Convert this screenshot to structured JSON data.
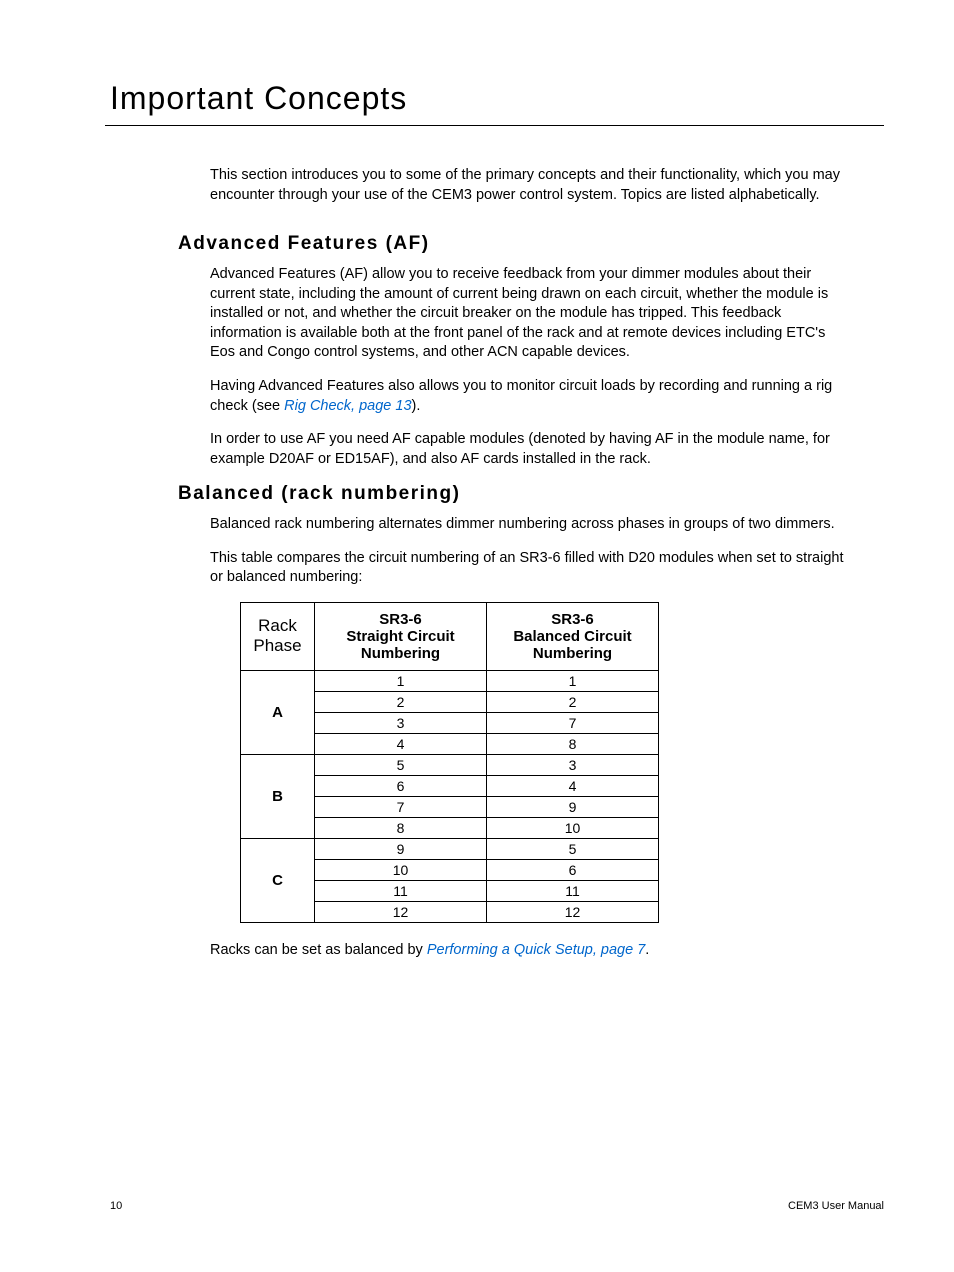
{
  "title": "Important Concepts",
  "intro": "This section introduces you to some of the primary concepts and their functionality, which you may encounter through your use of the CEM3 power control system. Topics are listed alphabetically.",
  "af": {
    "heading": "Advanced Features (AF)",
    "p1": "Advanced Features (AF) allow you to receive feedback from your dimmer modules about their current state, including the amount of current being drawn on each circuit, whether the module is installed or not, and whether the circuit breaker on the module has tripped. This feedback information is available both at the front panel of the rack and at remote devices including ETC's Eos and Congo control systems, and other ACN capable devices.",
    "p2_before": "Having Advanced Features also allows you to monitor circuit loads by recording and running a rig check (see ",
    "p2_link": "Rig Check, page 13",
    "p2_after": ").",
    "p3": "In order to use AF you need AF capable modules (denoted by having AF in the module name, for example D20AF or ED15AF), and also AF cards installed in the rack."
  },
  "balanced": {
    "heading": "Balanced (rack numbering)",
    "p1": "Balanced rack numbering alternates dimmer numbering across phases in groups of two dimmers.",
    "p2": "This table compares the circuit numbering of an SR3-6 filled with D20 modules when set to straight or balanced numbering:",
    "p3_before": "Racks can be set as balanced by ",
    "p3_link": "Performing a Quick Setup, page 7",
    "p3_after": "."
  },
  "table": {
    "headers": {
      "phase": "Rack Phase",
      "straight_l1": "SR3-6",
      "straight_l2": "Straight Circuit Numbering",
      "balanced_l1": "SR3-6",
      "balanced_l2": "Balanced Circuit Numbering"
    },
    "groups": [
      {
        "phase": "A",
        "rows": [
          {
            "s": "1",
            "b": "1"
          },
          {
            "s": "2",
            "b": "2"
          },
          {
            "s": "3",
            "b": "7"
          },
          {
            "s": "4",
            "b": "8"
          }
        ]
      },
      {
        "phase": "B",
        "rows": [
          {
            "s": "5",
            "b": "3"
          },
          {
            "s": "6",
            "b": "4"
          },
          {
            "s": "7",
            "b": "9"
          },
          {
            "s": "8",
            "b": "10"
          }
        ]
      },
      {
        "phase": "C",
        "rows": [
          {
            "s": "9",
            "b": "5"
          },
          {
            "s": "10",
            "b": "6"
          },
          {
            "s": "11",
            "b": "11"
          },
          {
            "s": "12",
            "b": "12"
          }
        ]
      }
    ]
  },
  "footer": {
    "page": "10",
    "doc": "CEM3 User Manual"
  }
}
